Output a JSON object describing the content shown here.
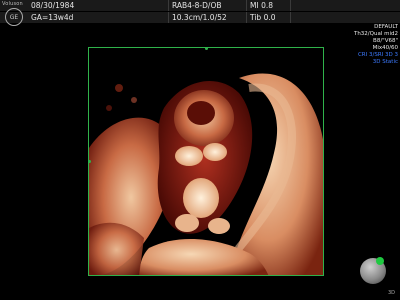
{
  "header": {
    "logo_text": "Voluson",
    "logo_badge": "GE",
    "row1": {
      "date": "08/30/1984",
      "probe": "RAB4-8-D/OB",
      "mi": "MI 0.8"
    },
    "row2": {
      "ga": "GA=13w4d",
      "depth_info": "10.3cm/1.0/52",
      "tib": "Tib 0.0"
    }
  },
  "right_panel": {
    "lines": [
      {
        "text": "DEFAULT",
        "color": "white"
      },
      {
        "text": "Th32/Qual mid2",
        "color": "white"
      },
      {
        "text": "B8/\"V68\"",
        "color": "white"
      },
      {
        "text": "Mix40/60",
        "color": "white"
      },
      {
        "text": "CRI 3/SRI 3D 3",
        "color": "blue"
      },
      {
        "text": "3D Static",
        "color": "blue"
      }
    ]
  },
  "orientation": {
    "label": "3D"
  },
  "colors": {
    "frame": "#2fb24a",
    "accent_blue": "#3d7bff",
    "header_bg": "#1a1a1a"
  }
}
